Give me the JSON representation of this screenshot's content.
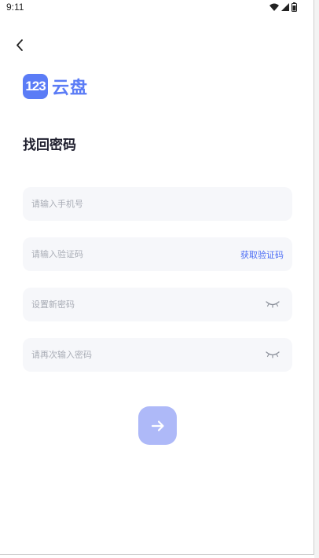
{
  "status_bar": {
    "time": "9:11"
  },
  "header": {
    "back_icon": "chevron-left-icon"
  },
  "brand": {
    "badge_text": "123",
    "name": "云盘",
    "color": "#5b7cf6"
  },
  "page": {
    "title": "找回密码"
  },
  "form": {
    "phone": {
      "value": "",
      "placeholder": "请输入手机号"
    },
    "code": {
      "value": "",
      "placeholder": "请输入验证码",
      "action_label": "获取验证码"
    },
    "new_password": {
      "value": "",
      "placeholder": "设置新密码",
      "toggle_icon": "eye-closed-icon"
    },
    "confirm_password": {
      "value": "",
      "placeholder": "请再次输入密码",
      "toggle_icon": "eye-closed-icon"
    },
    "submit_icon": "arrow-right-icon"
  },
  "colors": {
    "accent": "#4d6ef5",
    "submit_disabled": "#aeb9f8",
    "field_bg": "#f6f7fa"
  }
}
